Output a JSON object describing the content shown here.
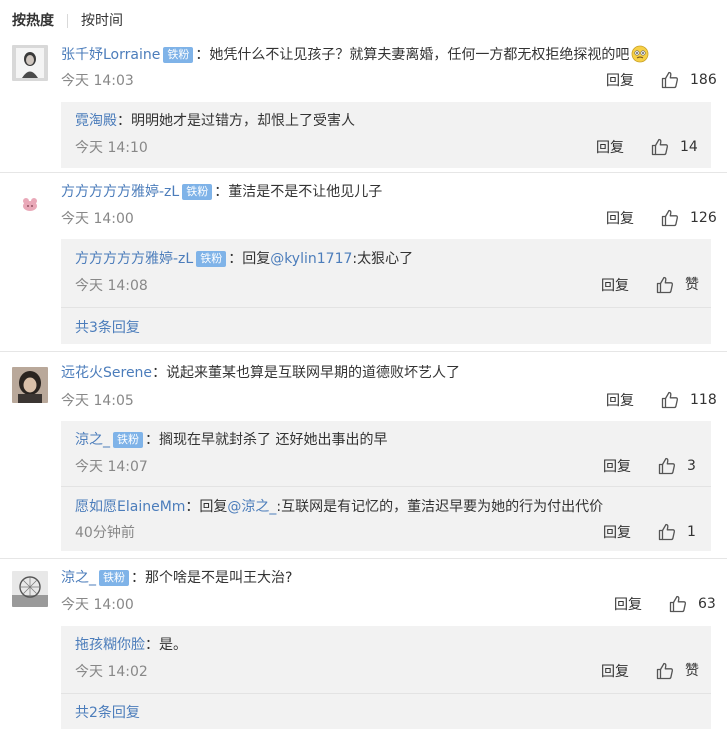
{
  "sort": {
    "hot": "按热度",
    "time": "按时间"
  },
  "actions": {
    "reply": "回复",
    "like": "赞"
  },
  "colors": {
    "link": "#4c7dbb",
    "badge": "#7fb3e8",
    "reply_bg": "#f2f2f2",
    "muted": "#888888"
  },
  "comments": [
    {
      "user": "张千妤Lorraine",
      "badge": "铁粉",
      "text": "她凭什么不让见孩子？就算夫妻离婚，任何一方都无权拒绝探视的吧",
      "emoji": "confused-face-emoji",
      "time": "今天 14:03",
      "likes": "186",
      "replies": [
        {
          "user": "霓淘殿",
          "text": "明明她才是过错方，却恨上了受害人",
          "time": "今天 14:10",
          "likes": "14"
        }
      ]
    },
    {
      "user": "方方方方方雅婷-zL",
      "badge": "铁粉",
      "text": "董洁是不是不让他见儿子",
      "time": "今天 14:00",
      "likes": "126",
      "replies": [
        {
          "user": "方方方方方雅婷-zL",
          "badge": "铁粉",
          "prefix": "回复",
          "mention": "@kylin1717",
          "text": ":太狠心了",
          "time": "今天 14:08",
          "likes": "赞"
        }
      ],
      "more": "共3条回复"
    },
    {
      "user": "远花火Serene",
      "text": "说起来董某也算是互联网早期的道德败坏艺人了",
      "time": "今天 14:05",
      "likes": "118",
      "replies": [
        {
          "user": "涼之_",
          "badge": "铁粉",
          "text": "搁现在早就封杀了 还好她出事出的早",
          "time": "今天 14:07",
          "likes": "3"
        },
        {
          "user": "愿如愿ElaineMm",
          "prefix": "回复",
          "mention": "@涼之_",
          "text": ":互联网是有记忆的，董洁迟早要为她的行为付出代价",
          "time": "40分钟前",
          "likes": "1"
        }
      ]
    },
    {
      "user": "涼之_",
      "badge": "铁粉",
      "text": "那个啥是不是叫王大治?",
      "time": "今天 14:00",
      "likes": "63",
      "replies": [
        {
          "user": "拖孩糊你脸",
          "text": "是。",
          "time": "今天 14:02",
          "likes": "赞"
        }
      ],
      "more": "共2条回复"
    }
  ]
}
